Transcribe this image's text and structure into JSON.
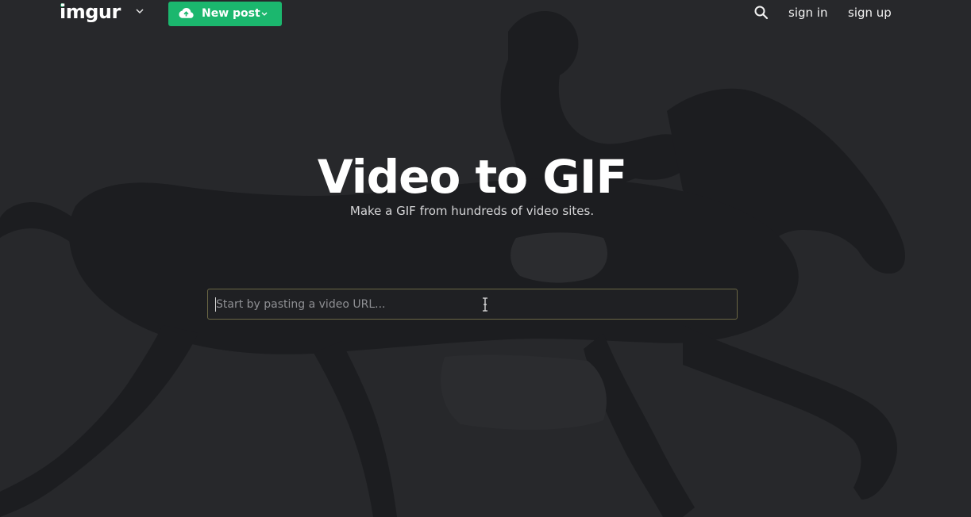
{
  "header": {
    "logo_text": "imgur",
    "logo_dot_color": "#1bb76e",
    "logo_menu_icon": "chevron-down-icon",
    "new_post_label": "New post",
    "new_post_icon": "cloud-upload-icon",
    "new_post_color": "#1bb76e",
    "search_icon": "search-icon",
    "sign_in_label": "sign in",
    "sign_up_label": "sign up"
  },
  "hero": {
    "title": "Video to GIF",
    "subtitle": "Make a GIF from hundreds of video sites."
  },
  "url_input": {
    "placeholder": "Start by pasting a video URL...",
    "value": ""
  },
  "colors": {
    "background": "#26272a",
    "input_border": "#6b6744"
  }
}
